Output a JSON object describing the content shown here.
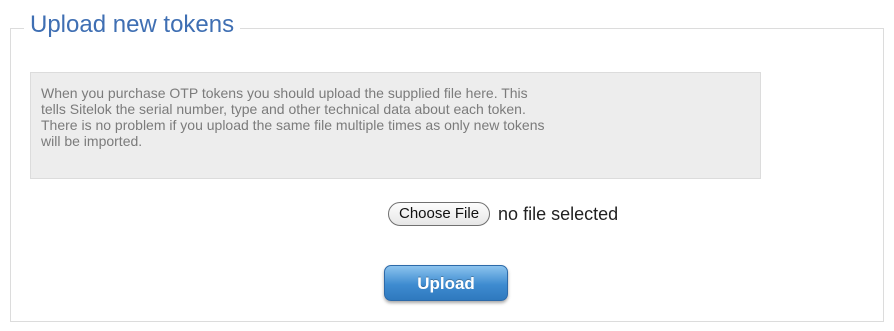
{
  "section": {
    "title": "Upload new tokens"
  },
  "info": {
    "lines": [
      "When you purchase OTP tokens you should upload the supplied file here. This",
      "tells Sitelok the serial number, type and other technical data about each token.",
      "There is no problem if you upload the same file multiple times as only new tokens",
      "will be imported."
    ]
  },
  "file_input": {
    "button_label": "Choose File",
    "status": "no file selected"
  },
  "upload": {
    "button_label": "Upload"
  },
  "colors": {
    "title": "#3f6fb3",
    "info_background": "#ededed",
    "upload_button": "#3e8bd0"
  }
}
